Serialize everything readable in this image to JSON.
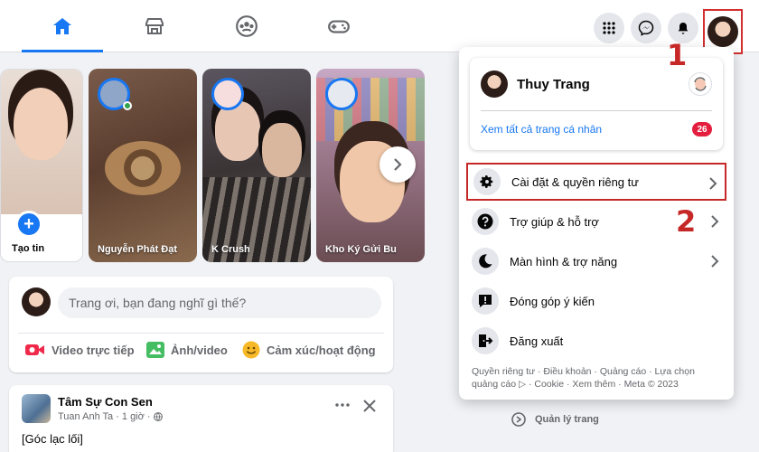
{
  "stories": [
    {
      "name": "Tạo tin",
      "create_label": "+"
    },
    {
      "name": "Nguyễn Phát Đạt"
    },
    {
      "name": "K Crush"
    },
    {
      "name": "Kho Ký Gửi Bu"
    }
  ],
  "composer": {
    "placeholder": "Trang ơi, bạn đang nghĩ gì thế?",
    "actions": [
      "Video trực tiếp",
      "Ảnh/video",
      "Cảm xúc/hoạt động"
    ]
  },
  "post": {
    "page_name": "Tâm Sự Con Sen",
    "author": "Tuan Anh Ta",
    "time": "· 1 giờ ·",
    "text": "[Góc lạc lối]"
  },
  "menu": {
    "profile_name": "Thuy Trang",
    "see_all_profiles": "Xem tất cả trang cá nhân",
    "badge_count": "26",
    "items": [
      {
        "label": "Cài đặt & quyền riêng tư"
      },
      {
        "label": "Trợ giúp & hỗ trợ"
      },
      {
        "label": "Màn hình & trợ năng"
      },
      {
        "label": "Đóng góp ý kiến"
      },
      {
        "label": "Đăng xuất"
      }
    ],
    "footer": "Quyền riêng tư · Điều khoản · Quảng cáo · Lựa chọn quảng cáo ▷ · Cookie · Xem thêm · Meta © 2023"
  },
  "background_link": "Quản lý trang",
  "callouts": {
    "one": "1",
    "two": "2"
  },
  "colors": {
    "brand": "#1877f2",
    "callout_red": "#c62828",
    "badge_red": "#e41e3f"
  }
}
